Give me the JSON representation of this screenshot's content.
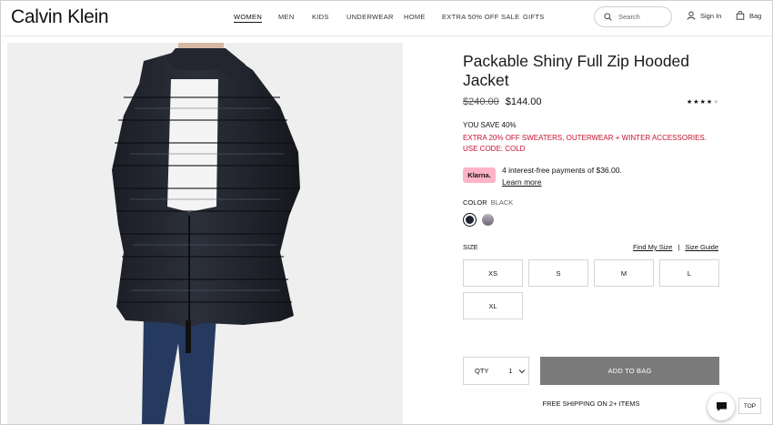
{
  "header": {
    "logo": "Calvin Klein",
    "nav": [
      "WOMEN",
      "MEN",
      "KIDS",
      "UNDERWEAR",
      "HOME",
      "EXTRA 50% OFF SALE",
      "GIFTS"
    ],
    "search_placeholder": "Search",
    "sign_in": "Sign In",
    "bag": "Bag"
  },
  "product": {
    "title": "Packable Shiny Full Zip Hooded Jacket",
    "original_price": "$240.00",
    "sale_price": "$144.00",
    "rating": 4,
    "rating_max": 5,
    "you_save": "YOU SAVE 40%",
    "promo": "EXTRA 20% OFF SWEATERS, OUTERWEAR + WINTER ACCESSORIES. USE CODE: COLD",
    "klarna": {
      "badge": "Klarna.",
      "text": "4 interest-free payments of $36.00.",
      "link": "Learn more",
      "color": "#ffb3c7"
    },
    "color_label": "COLOR",
    "color_value": "BLACK",
    "size_label": "SIZE",
    "find_my_size": "Find My Size",
    "separator": "|",
    "size_guide": "Size Guide",
    "sizes": [
      "XS",
      "S",
      "M",
      "L",
      "XL"
    ],
    "qty_label": "QTY",
    "qty_value": "1",
    "add_to_bag": "ADD TO BAG",
    "free_shipping": "FREE SHIPPING ON 2+ ITEMS"
  },
  "floating": {
    "top": "TOP"
  }
}
